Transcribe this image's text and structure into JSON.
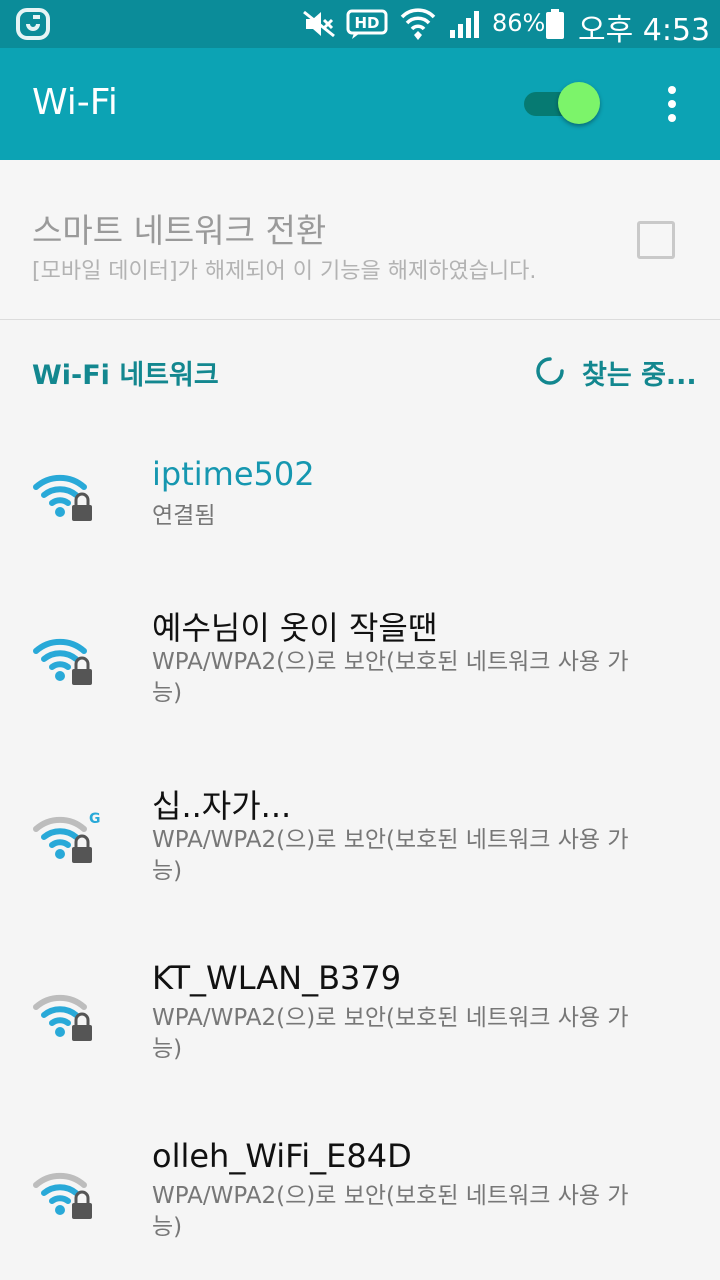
{
  "status_bar": {
    "battery_percent": "86%",
    "time": "오후 4:53",
    "icons": [
      "carrier-logo-icon",
      "mute-icon",
      "hd-voice-icon",
      "wifi-data-icon",
      "cell-signal-icon",
      "battery-icon"
    ],
    "hd_label": "HD"
  },
  "app_bar": {
    "title": "Wi-Fi",
    "toggle_on": true,
    "accent_color": "#0ca3b4",
    "status_color": "#0b8c99",
    "thumb_color": "#7cf46a"
  },
  "smart_switch": {
    "title": "스마트 네트워크 전환",
    "subtitle": "[모바일 데이터]가 해제되어 이 기능을 해제하였습니다.",
    "checked": false
  },
  "list_header": {
    "label": "Wi-Fi 네트워크",
    "scanning_text": "찾는 중..."
  },
  "networks": [
    {
      "name": "iptime502",
      "status": "연결됨",
      "connected": true,
      "strength": 1.0,
      "band_badge": ""
    },
    {
      "name": "예수님이 옷이 작을땐",
      "status": "WPA/WPA2(으)로 보안(보호된 네트워크 사용 가능)",
      "connected": false,
      "strength": 1.0,
      "band_badge": ""
    },
    {
      "name": "십..자가...",
      "status": "WPA/WPA2(으)로 보안(보호된 네트워크 사용 가능)",
      "connected": false,
      "strength": 0.66,
      "band_badge": "G"
    },
    {
      "name": "KT_WLAN_B379",
      "status": "WPA/WPA2(으)로 보안(보호된 네트워크 사용 가능)",
      "connected": false,
      "strength": 0.66,
      "band_badge": ""
    },
    {
      "name": "olleh_WiFi_E84D",
      "status": "WPA/WPA2(으)로 보안(보호된 네트워크 사용 가능)",
      "connected": false,
      "strength": 0.66,
      "band_badge": ""
    }
  ],
  "colors": {
    "wifi_active": "#29a9d8",
    "wifi_inactive": "#bdbdbd",
    "lock": "#555555",
    "header_text": "#13878f"
  }
}
